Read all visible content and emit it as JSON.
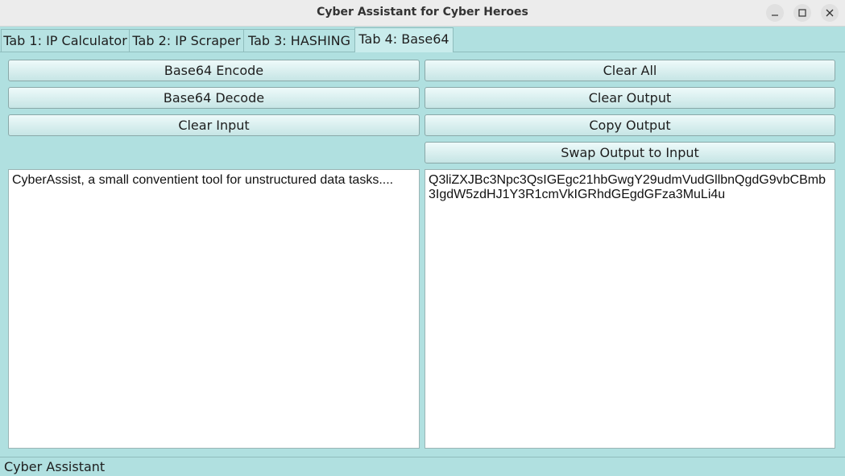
{
  "window": {
    "title": "Cyber Assistant for Cyber Heroes",
    "controls": {
      "minimize_icon": "minimize-icon",
      "maximize_icon": "maximize-icon",
      "close_icon": "close-icon"
    }
  },
  "tabs": [
    {
      "label": "Tab 1: IP Calculator",
      "active": false
    },
    {
      "label": "Tab 2: IP Scraper",
      "active": false
    },
    {
      "label": "Tab 3: HASHING",
      "active": false
    },
    {
      "label": "Tab 4: Base64",
      "active": true
    }
  ],
  "buttons": {
    "left": [
      "Base64 Encode",
      "Base64 Decode",
      "Clear Input"
    ],
    "right": [
      "Clear All",
      "Clear Output",
      "Copy Output",
      "Swap Output to Input"
    ]
  },
  "input": {
    "value": "CyberAssist, a small conventient tool for unstructured data tasks...."
  },
  "output": {
    "value": "Q3liZXJBc3Npc3QsIGEgc21hbGwgY29udmVudGllbnQgdG9vbCBmb3IgdW5zdHJ1Y3R1cmVkIGRhdGEgdGFza3MuLi4u"
  },
  "status": {
    "text": "Cyber Assistant"
  },
  "colors": {
    "background": "#b0e0e0",
    "tab_active": "#c9ecec",
    "titlebar": "#ececec"
  }
}
